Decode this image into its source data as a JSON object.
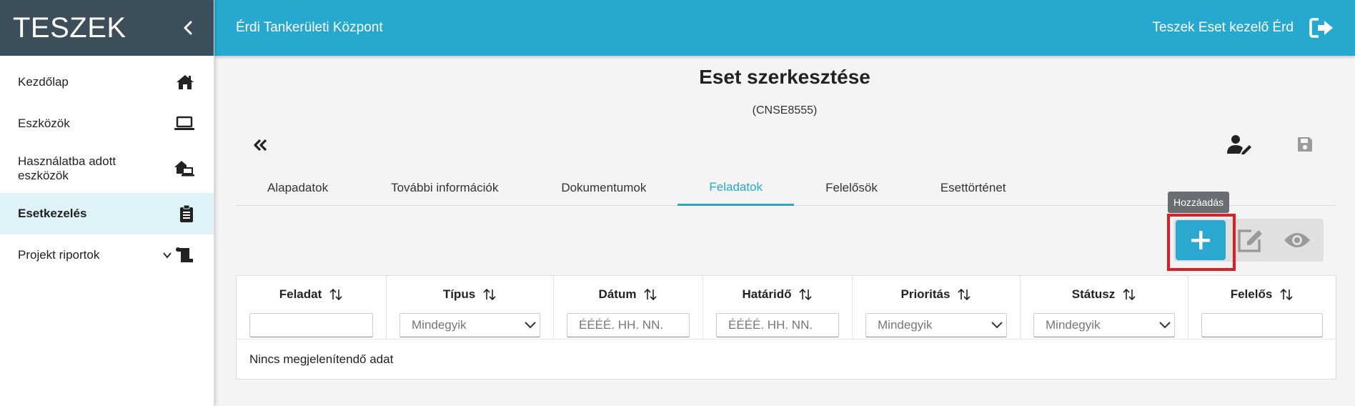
{
  "app": {
    "brand": "TESZEK"
  },
  "sidebar": {
    "items": [
      {
        "label": "Kezdőlap",
        "icon": "home-icon"
      },
      {
        "label": "Eszközök",
        "icon": "laptop-icon"
      },
      {
        "label": "Használatba adott eszközök",
        "icon": "house-laptop-icon"
      },
      {
        "label": "Esetkezelés",
        "icon": "clipboard-icon",
        "active": true
      },
      {
        "label": "Projekt riportok",
        "icon": "scroll-icon",
        "expandable": true
      }
    ]
  },
  "header": {
    "title": "Érdi Tankerületi Központ",
    "user": "Teszek Eset kezelő Érd"
  },
  "page": {
    "title": "Eset szerkesztése",
    "case_id": "(CNSE8555)"
  },
  "tabs": [
    {
      "label": "Alapadatok"
    },
    {
      "label": "További információk"
    },
    {
      "label": "Dokumentumok"
    },
    {
      "label": "Feladatok",
      "active": true
    },
    {
      "label": "Felelősök"
    },
    {
      "label": "Esettörténet"
    }
  ],
  "toolbar": {
    "tooltip": "Hozzáadás"
  },
  "grid": {
    "columns": [
      {
        "title": "Feladat",
        "filter_type": "text",
        "filter_value": ""
      },
      {
        "title": "Típus",
        "filter_type": "select",
        "filter_value": "Mindegyik"
      },
      {
        "title": "Dátum",
        "filter_type": "date",
        "filter_value": "ÉÉÉÉ. HH. NN."
      },
      {
        "title": "Határidő",
        "filter_type": "date",
        "filter_value": "ÉÉÉÉ. HH. NN."
      },
      {
        "title": "Prioritás",
        "filter_type": "select",
        "filter_value": "Mindegyik"
      },
      {
        "title": "Státusz",
        "filter_type": "select",
        "filter_value": "Mindegyik"
      },
      {
        "title": "Felelős",
        "filter_type": "text",
        "filter_value": ""
      }
    ],
    "empty_text": "Nincs megjelenítendő adat"
  },
  "colors": {
    "primary": "#27a9cf",
    "sidebar_header": "#3b4e5a",
    "active_nav_bg": "#dff2f8",
    "highlight": "#e01c24"
  }
}
